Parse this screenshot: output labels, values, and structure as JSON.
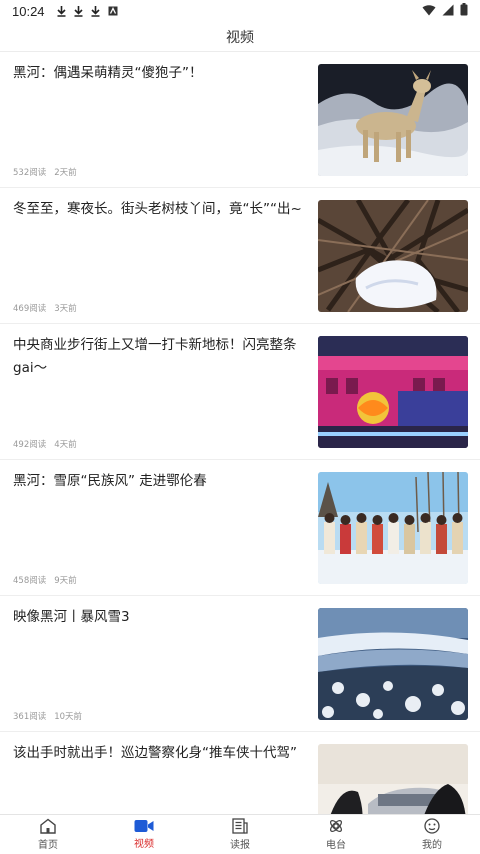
{
  "status_bar": {
    "time": "10:24",
    "left_icons": [
      "download-icon",
      "download-icon",
      "download-icon",
      "app-notification-icon"
    ],
    "right_icons": [
      "wifi-icon",
      "signal-icon",
      "battery-icon"
    ]
  },
  "header": {
    "title": "视频"
  },
  "feed": {
    "items": [
      {
        "title": "黑河：偶遇呆萌精灵“傻狍子”！",
        "reads": "532阅读",
        "time": "2天前",
        "thumb_icon": "roe-deer-thumbnail"
      },
      {
        "title": "冬至至，寒夜长。街头老树枝丫间，竟“长”“出~",
        "reads": "469阅读",
        "time": "3天前",
        "thumb_icon": "tree-branches-thumbnail"
      },
      {
        "title": "中央商业步行街上又增一打卡新地标！闪亮整条gai～",
        "reads": "492阅读",
        "time": "4天前",
        "thumb_icon": "lit-building-thumbnail"
      },
      {
        "title": "黑河：雪原“民族风” 走进鄂伦春",
        "reads": "458阅读",
        "time": "9天前",
        "thumb_icon": "snow-dancers-thumbnail"
      },
      {
        "title": "映像黑河丨暴风雪3",
        "reads": "361阅读",
        "time": "10天前",
        "thumb_icon": "snowy-river-thumbnail"
      },
      {
        "title": "该出手时就出手！巡边警察化身“推车侠十代驾”",
        "reads": "",
        "time": "",
        "thumb_icon": "push-car-thumbnail"
      }
    ]
  },
  "tabbar": {
    "active": "视频",
    "tabs": [
      {
        "label": "首页",
        "icon": "home-icon"
      },
      {
        "label": "视频",
        "icon": "video-camera-icon"
      },
      {
        "label": "读报",
        "icon": "newspaper-icon"
      },
      {
        "label": "电台",
        "icon": "radio-icon"
      },
      {
        "label": "我的",
        "icon": "profile-icon"
      }
    ]
  },
  "colors": {
    "accent": "#d92b2b",
    "active_icon": "#1e5bd6",
    "meta_text": "#999999",
    "divider": "#eeeeee"
  }
}
